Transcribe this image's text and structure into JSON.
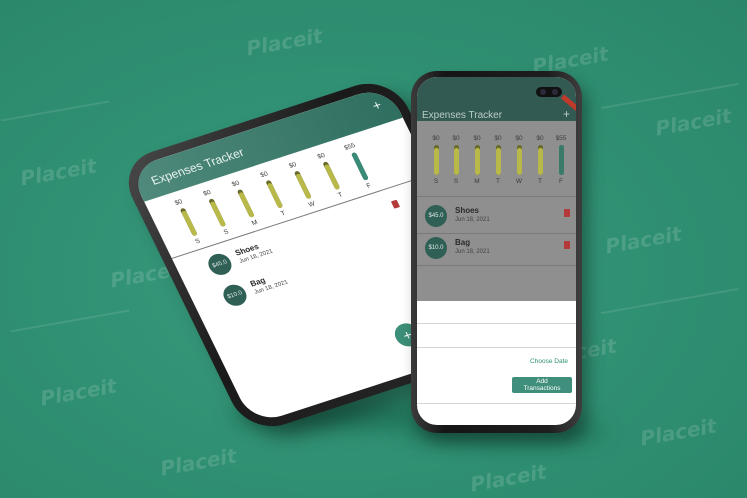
{
  "watermark": {
    "text": "Placeit"
  },
  "app": {
    "title": "Expenses Tracker",
    "add_icon": "plus-icon",
    "accent_color": "#2f6f60",
    "bar_color": "#b9b94a"
  },
  "chart": {
    "days": [
      {
        "day": "S",
        "amount": "$0",
        "fill": 0.9
      },
      {
        "day": "S",
        "amount": "$0",
        "fill": 0.9
      },
      {
        "day": "M",
        "amount": "$0",
        "fill": 0.9
      },
      {
        "day": "T",
        "amount": "$0",
        "fill": 0.9
      },
      {
        "day": "W",
        "amount": "$0",
        "fill": 0.9
      },
      {
        "day": "T",
        "amount": "$0",
        "fill": 0.9
      },
      {
        "day": "F",
        "amount": "$55",
        "fill": 1.0
      }
    ]
  },
  "transactions": [
    {
      "avatar": "$45.0",
      "name": "Shoes",
      "date": "Jun 18, 2021"
    },
    {
      "avatar": "$10.0",
      "name": "Bag",
      "date": "Jun 18, 2021"
    }
  ],
  "form": {
    "choose_date_label": "Choose Date",
    "add_button_label": "Add Transactions"
  },
  "fab": {
    "label": "+"
  }
}
